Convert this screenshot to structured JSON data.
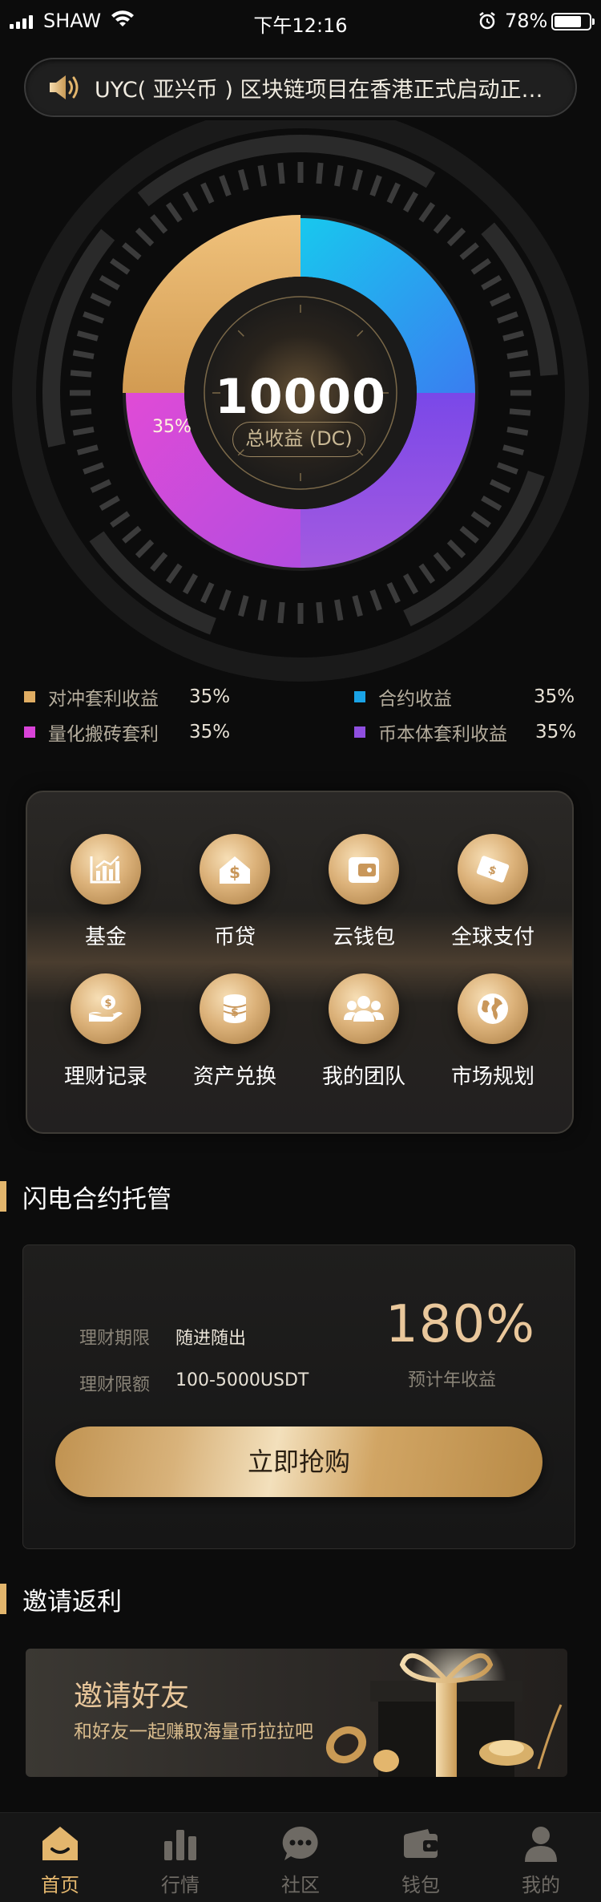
{
  "status_bar": {
    "carrier": "SHAW",
    "time": "下午12:16",
    "battery_pct": "78%",
    "battery_level": 0.78
  },
  "notice": {
    "icon": "speaker-icon",
    "text": "UYC( 亚兴币 ) 区块链项目在香港正式启动正式上线"
  },
  "summary": {
    "total_value": "10000",
    "total_label": "总收益 (DC)",
    "highlight_pct": "35%"
  },
  "chart_data": {
    "type": "pie",
    "center_value": 10000,
    "center_label": "总收益 (DC)",
    "slices": [
      {
        "name": "对冲套利收益",
        "value": 35,
        "pct_label": "35%",
        "color": "#e0ad63"
      },
      {
        "name": "合约收益",
        "value": 35,
        "pct_label": "35%",
        "color": "#1aa3e6"
      },
      {
        "name": "量化搬砖套利",
        "value": 35,
        "pct_label": "35%",
        "color": "#d943d8"
      },
      {
        "name": "币本体套利收益",
        "value": 35,
        "pct_label": "35%",
        "color": "#8f4fe0"
      }
    ],
    "legend_placement": "bottom"
  },
  "menu": {
    "items": [
      {
        "label": "基金",
        "icon": "fund-chart-icon"
      },
      {
        "label": "币贷",
        "icon": "loan-house-icon"
      },
      {
        "label": "云钱包",
        "icon": "wallet-icon"
      },
      {
        "label": "全球支付",
        "icon": "payment-card-icon"
      },
      {
        "label": "理财记录",
        "icon": "money-hand-icon"
      },
      {
        "label": "资产兑换",
        "icon": "coin-stack-icon"
      },
      {
        "label": "我的团队",
        "icon": "team-icon"
      },
      {
        "label": "市场规划",
        "icon": "globe-icon"
      }
    ]
  },
  "flash_contract": {
    "section_title": "闪电合约托管",
    "term_label": "理财期限",
    "term_value": "随进随出",
    "amount_label": "理财限额",
    "amount_value": "100-5000USDT",
    "rate_value": "180%",
    "rate_label": "预计年收益",
    "buy_label": "立即抢购"
  },
  "invite": {
    "section_title": "邀请返利",
    "banner_title": "邀请好友",
    "banner_sub": "和好友一起赚取海量币拉拉吧"
  },
  "tabbar": {
    "tabs": [
      {
        "label": "首页",
        "icon": "home-icon",
        "active": true
      },
      {
        "label": "行情",
        "icon": "market-chart-icon",
        "active": false
      },
      {
        "label": "社区",
        "icon": "chat-bubble-icon",
        "active": false
      },
      {
        "label": "钱包",
        "icon": "wallet-icon",
        "active": false
      },
      {
        "label": "我的",
        "icon": "user-icon",
        "active": false
      }
    ]
  },
  "colors": {
    "accent_gold": "#e3b66d",
    "background": "#0c0c0c",
    "tab_inactive": "#6e6a64"
  }
}
